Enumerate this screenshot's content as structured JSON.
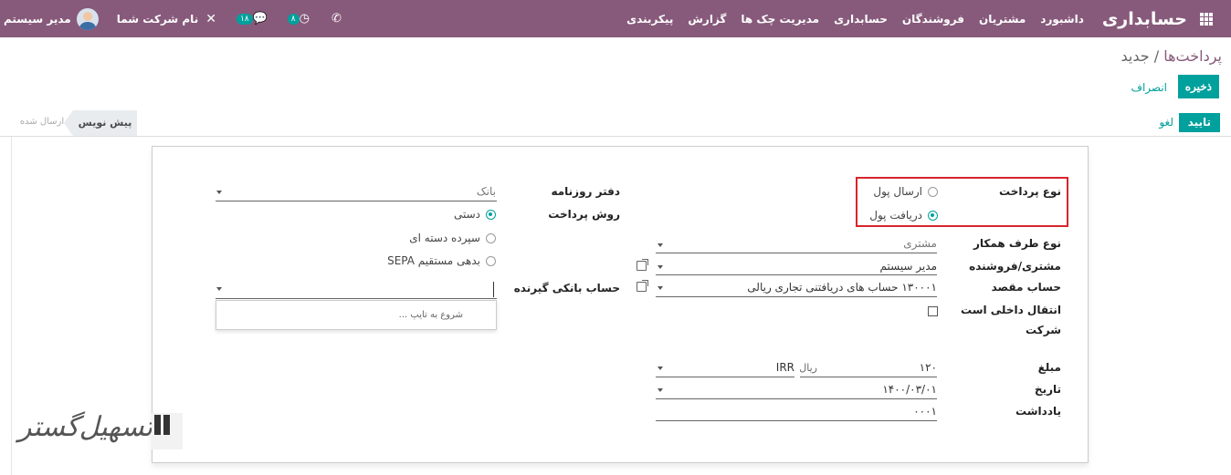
{
  "navbar": {
    "brand": "حسابداری",
    "menu": [
      "داشبورد",
      "مشتریان",
      "فروشندگان",
      "حسابداری",
      "مدیریت چک ها",
      "گزارش",
      "پیکربندی"
    ],
    "user_name": "مدیر سیستم",
    "company": "نام شرکت شما",
    "badge_messages": "۱۸",
    "badge_activities": "۸"
  },
  "breadcrumb": {
    "parent": "پرداخت‌ها",
    "separator": "/",
    "current": "جدید"
  },
  "buttons": {
    "save": "ذخیره",
    "discard": "انصراف",
    "confirm": "تایید",
    "cancel": "لغو"
  },
  "status": {
    "draft": "پیش نویس",
    "sent": "ارسال شده"
  },
  "form": {
    "payment_type_label": "نوع پرداخت",
    "payment_type_options": [
      {
        "label": "ارسال پول",
        "selected": false
      },
      {
        "label": "دریافت پول",
        "selected": true
      }
    ],
    "partner_type_label": "نوع طرف همکار",
    "partner_type_value": "مشتری",
    "partner_label": "مشتری/فروشنده",
    "partner_value": "مدیر سیستم",
    "dest_account_label": "حساب مقصد",
    "dest_account_value": "۱۳۰۰۰۱ حساب های دریافتنی تجاری ریالی",
    "internal_transfer_label": "انتقال داخلی است",
    "company_label": "شرکت",
    "amount_label": "مبلغ",
    "amount_value": "۱۲۰",
    "currency_name": "ریال",
    "currency_code": "IRR",
    "date_label": "تاریخ",
    "date_value": "۱۴۰۰/۰۳/۰۱",
    "memo_label": "یادداشت",
    "memo_value": "۰۰۰۱",
    "journal_label": "دفتر روزنامه",
    "journal_value": "بانک",
    "payment_method_label": "روش پرداخت",
    "payment_methods": [
      {
        "label": "دستی",
        "selected": true
      },
      {
        "label": "سپرده دسته ای",
        "selected": false
      },
      {
        "label": "بدهی مستقیم SEPA",
        "selected": false
      }
    ],
    "recipient_bank_label": "حساب بانکی گیرنده",
    "dropdown_hint": "شروع به تایپ ..."
  },
  "watermark": {
    "text": "تسهیل‌گستر"
  },
  "colors": {
    "navbar": "#875a7b",
    "primary": "#00a09d",
    "highlight": "#d9232d"
  }
}
